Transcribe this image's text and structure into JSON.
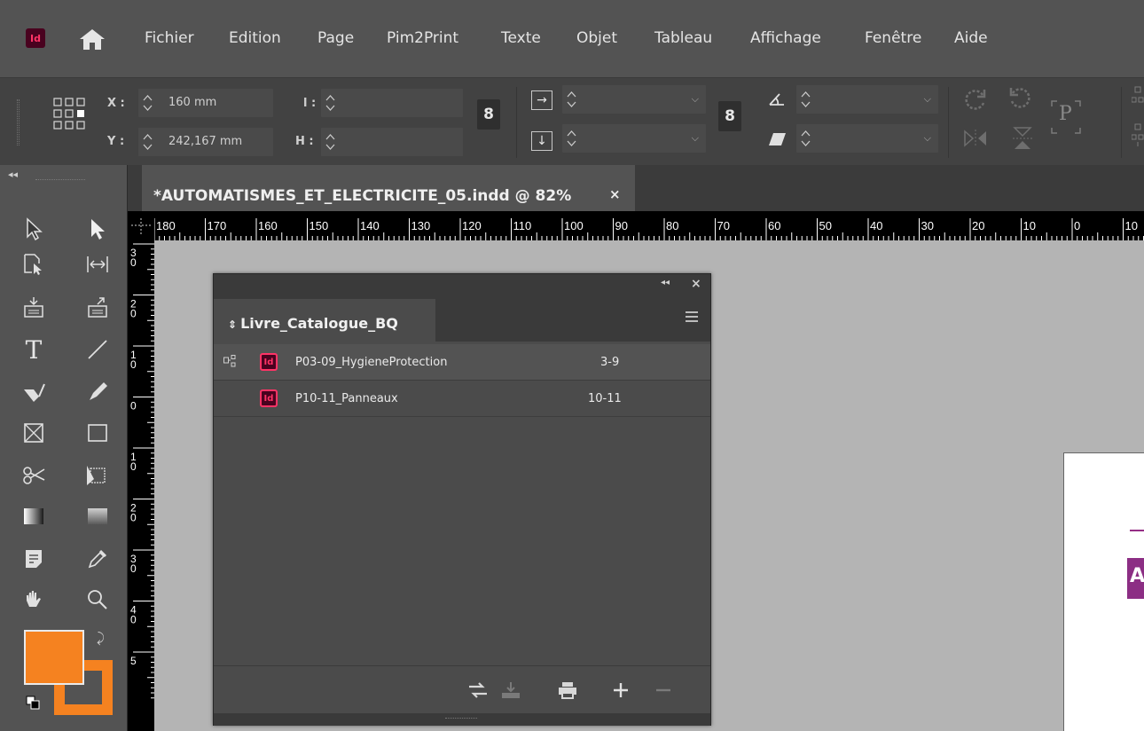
{
  "app": {
    "icon_label": "Id",
    "menus": [
      "Fichier",
      "Edition",
      "Page",
      "Pim2Print",
      "Texte",
      "Objet",
      "Tableau",
      "Affichage",
      "Fenêtre",
      "Aide"
    ]
  },
  "control": {
    "x_label": "X :",
    "x_value": "160 mm",
    "y_label": "Y :",
    "y_value": "242,167 mm",
    "w_label": "l :",
    "w_value": "",
    "h_label": "H :",
    "h_value": "",
    "scale_x_value": "",
    "scale_y_value": "",
    "angle_value": "",
    "shear_value": "",
    "chain_glyph": "8",
    "frame_label": "P"
  },
  "document": {
    "tab_title": "*AUTOMATISMES_ET_ELECTRICITE_05.indd @ 82%",
    "close_glyph": "×"
  },
  "rulers": {
    "horizontal": [
      "180",
      "170",
      "160",
      "150",
      "140",
      "130",
      "120",
      "110",
      "100",
      "90",
      "80",
      "70",
      "60",
      "50",
      "40",
      "30",
      "20",
      "10",
      "0",
      "10"
    ],
    "vertical": [
      [
        "3",
        "0"
      ],
      [
        "2",
        "0"
      ],
      [
        "1",
        "0"
      ],
      [
        "0",
        ""
      ],
      [
        "1",
        "0"
      ],
      [
        "2",
        "0"
      ],
      [
        "3",
        "0"
      ],
      [
        "4",
        "0"
      ],
      [
        "5",
        ""
      ]
    ]
  },
  "book_panel": {
    "title": "Livre_Catalogue_BQ",
    "rows": [
      {
        "name": "P03-09_HygieneProtection",
        "pages": "3-9"
      },
      {
        "name": "P10-11_Panneaux",
        "pages": "10-11"
      }
    ],
    "footer_buttons": [
      "synchronize-icon",
      "save-book-icon",
      "print-book-icon",
      "add-document-icon",
      "remove-document-icon"
    ]
  },
  "colors": {
    "fill": "#f58220",
    "stroke": "#f58220",
    "accent": "#ff3366"
  },
  "page_fragment": {
    "visible_letter": "A"
  }
}
